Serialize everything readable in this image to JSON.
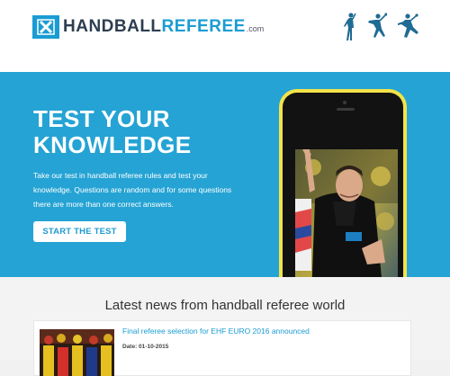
{
  "header": {
    "logo": {
      "brand_main": "HANDBALL",
      "brand_ref": "REFEREE",
      "brand_tld": ".com"
    },
    "player_icons": [
      "handball-player-standing-icon",
      "handball-player-jumping-icon",
      "handball-player-throwing-icon"
    ]
  },
  "hero": {
    "title": "TEST YOUR\nKNOWLEDGE",
    "description": "Take our test in handball referee rules and test your knowledge. Questions are random and for some questions there are more than one correct answers.",
    "cta_label": "START THE TEST"
  },
  "news": {
    "heading": "Latest news from handball referee world",
    "articles": [
      {
        "title": "Final referee selection for EHF EURO 2016 announced",
        "date": "Date: 01-10-2015"
      }
    ]
  },
  "colors": {
    "accent": "#25a3d4",
    "phone_body": "#f3e34a",
    "link": "#1a9cd3"
  }
}
